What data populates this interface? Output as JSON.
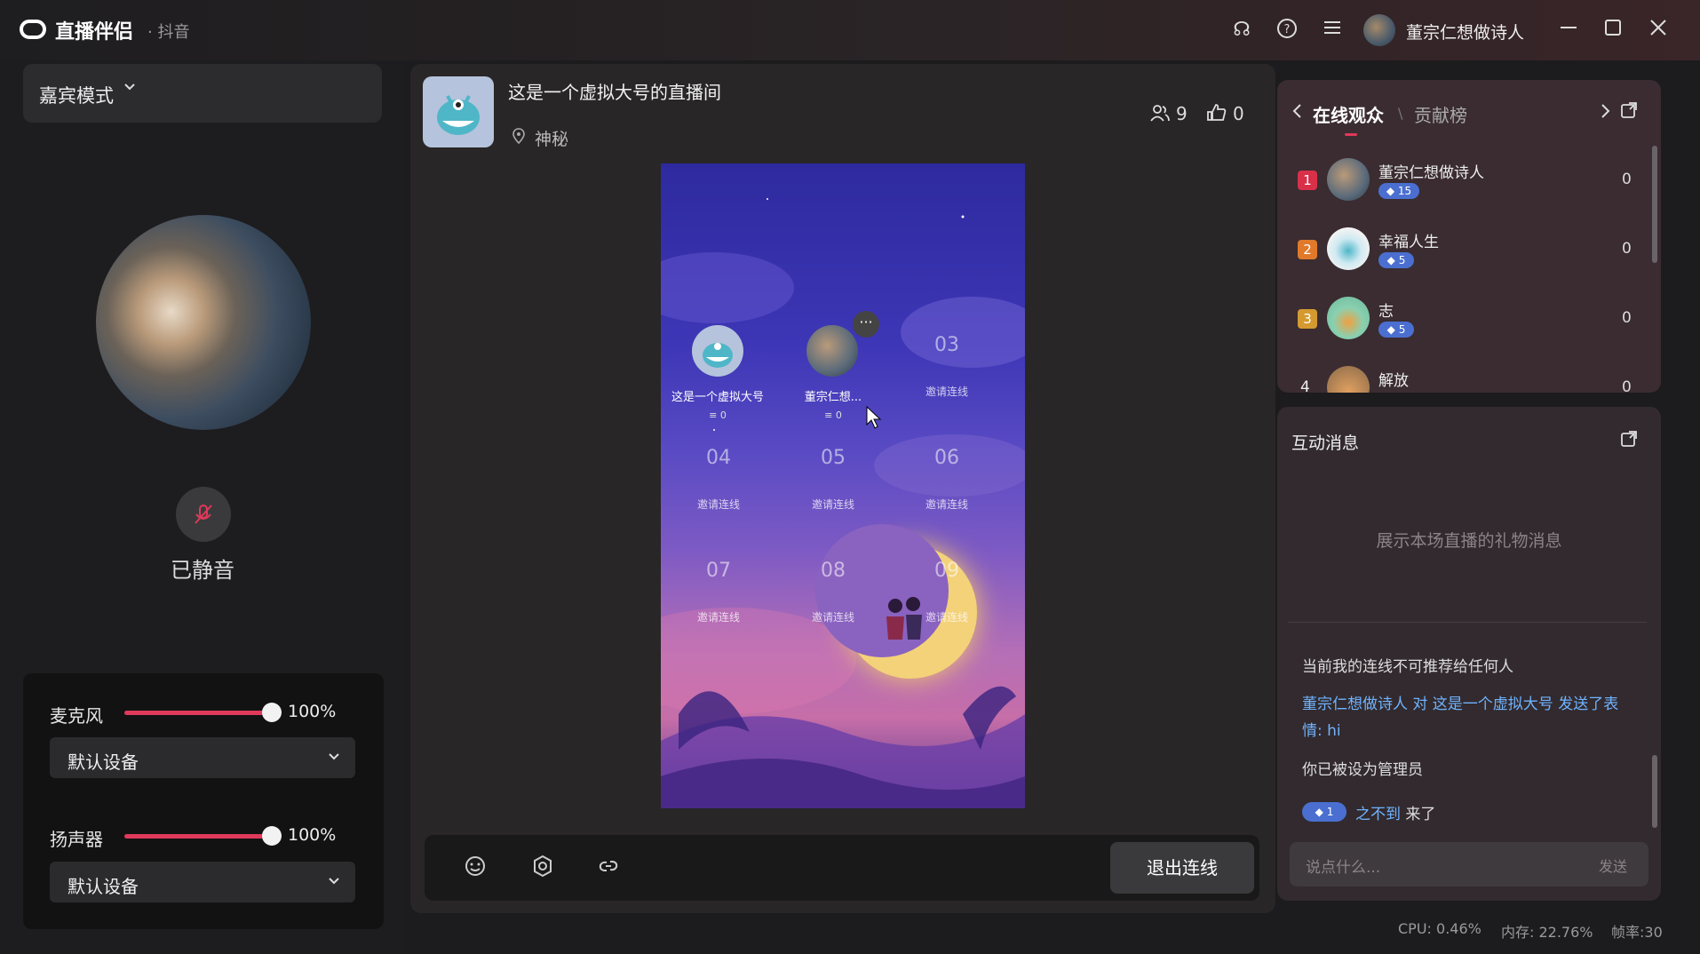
{
  "app": {
    "title": "直播伴侣",
    "platform": "· 抖音"
  },
  "header": {
    "user_name": "董宗仁想做诗人"
  },
  "left": {
    "mode": "嘉宾模式",
    "mute_text": "已静音",
    "mic_label": "麦克风",
    "mic_pct": "100%",
    "mic_level": 1.0,
    "mic_device": "默认设备",
    "spk_label": "扬声器",
    "spk_pct": "100%",
    "spk_level": 1.0,
    "spk_device": "默认设备"
  },
  "room": {
    "title": "这是一个虚拟大号的直播间",
    "location": "神秘",
    "viewers": "9",
    "likes": "0"
  },
  "seats": {
    "s1_name": "这是一个虚拟大号",
    "s1_count": "≡ 0",
    "s2_name": "董宗仁想...",
    "s2_count": "≡ 0",
    "s3_num": "03",
    "s4_num": "04",
    "s5_num": "05",
    "s6_num": "06",
    "s7_num": "07",
    "s8_num": "08",
    "s9_num": "09",
    "invite": "邀请连线"
  },
  "bottom": {
    "exit": "退出连线"
  },
  "audience": {
    "tab_online": "在线观众",
    "tab_contrib": "贡献榜",
    "rows": [
      {
        "rank": "1",
        "name": "董宗仁想做诗人",
        "level": "15",
        "value": "0"
      },
      {
        "rank": "2",
        "name": "幸福人生",
        "level": "5",
        "value": "0"
      },
      {
        "rank": "3",
        "name": "志",
        "level": "5",
        "value": "0"
      },
      {
        "rank": "4",
        "name": "解放",
        "level": "",
        "value": "0"
      }
    ]
  },
  "messages": {
    "title": "互动消息",
    "empty": "展示本场直播的礼物消息",
    "m1": "当前我的连线不可推荐给任何人",
    "m2_a": "董宗仁想做诗人 对 这是一个虚拟大号 发送了表",
    "m2_b": "情: hi",
    "m3": "你已被设为管理员",
    "m4_level": "1",
    "m4_name": "之不到",
    "m4_suffix": " 来了",
    "input_placeholder": "说点什么...",
    "send": "发送"
  },
  "status": {
    "cpu": "CPU: 0.46%",
    "mem": "内存: 22.76%",
    "fps": "帧率:30"
  },
  "colors": {
    "accent": "#e0395a",
    "link": "#6fb3ff",
    "rank1": "#d9304a",
    "rank2": "#e07a2a",
    "rank3": "#d49a30"
  }
}
